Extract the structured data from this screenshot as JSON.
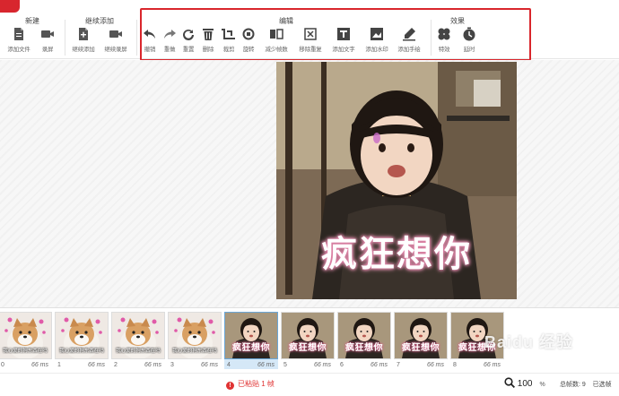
{
  "toolbar": {
    "groups": [
      {
        "title": "新建",
        "tools": [
          {
            "label": "添加文件",
            "icon": "add-file-icon"
          },
          {
            "label": "录屏",
            "icon": "record-screen-icon"
          }
        ]
      },
      {
        "title": "继续添加",
        "tools": [
          {
            "label": "继续添加",
            "icon": "continue-add-icon"
          },
          {
            "label": "继续录屏",
            "icon": "continue-record-icon"
          }
        ]
      },
      {
        "title": "编辑",
        "tools": [
          {
            "label": "撤销",
            "icon": "undo-icon"
          },
          {
            "label": "重做",
            "icon": "redo-icon"
          },
          {
            "label": "重置",
            "icon": "reset-icon"
          },
          {
            "label": "删除",
            "icon": "delete-icon"
          },
          {
            "label": "裁剪",
            "icon": "crop-icon"
          },
          {
            "label": "旋转",
            "icon": "rotate-icon"
          },
          {
            "label": "减少帧数",
            "icon": "reduce-frames-icon"
          },
          {
            "label": "移除重复",
            "icon": "remove-duplicates-icon"
          },
          {
            "label": "添加文字",
            "icon": "add-text-icon"
          },
          {
            "label": "添加水印",
            "icon": "add-watermark-icon"
          },
          {
            "label": "添加手绘",
            "icon": "add-drawing-icon"
          }
        ]
      },
      {
        "title": "效果",
        "tools": [
          {
            "label": "特效",
            "icon": "effects-icon"
          },
          {
            "label": "延时",
            "icon": "delay-icon"
          }
        ]
      }
    ]
  },
  "main_image": {
    "caption": "疯狂想你"
  },
  "frames": [
    {
      "index": "0",
      "duration": "66 ms",
      "caption": "我心爱的狗东西在吗",
      "kind": "dog"
    },
    {
      "index": "1",
      "duration": "66 ms",
      "caption": "我心爱的狗东西在吗",
      "kind": "dog"
    },
    {
      "index": "2",
      "duration": "66 ms",
      "caption": "我心爱的狗东西在吗",
      "kind": "dog"
    },
    {
      "index": "3",
      "duration": "66 ms",
      "caption": "我心爱的狗东西在吗",
      "kind": "dog"
    },
    {
      "index": "4",
      "duration": "66 ms",
      "caption": "疯狂想你",
      "kind": "girl",
      "selected": true
    },
    {
      "index": "5",
      "duration": "66 ms",
      "caption": "疯狂想你",
      "kind": "girl"
    },
    {
      "index": "6",
      "duration": "66 ms",
      "caption": "疯狂想你",
      "kind": "girl"
    },
    {
      "index": "7",
      "duration": "66 ms",
      "caption": "疯狂想你",
      "kind": "girl"
    },
    {
      "index": "8",
      "duration": "66 ms",
      "caption": "疯狂想你",
      "kind": "girl"
    }
  ],
  "status": {
    "message": "已粘贴 1 帧",
    "zoom_value": "100",
    "zoom_unit": "%",
    "total_frames_label": "总帧数: 9",
    "selected_label": "已选帧"
  },
  "watermark": "Baidu 经验",
  "colors": {
    "accent": "#d9262c",
    "selected_frame": "#d5e8f7",
    "status_warning": "#e03333"
  }
}
